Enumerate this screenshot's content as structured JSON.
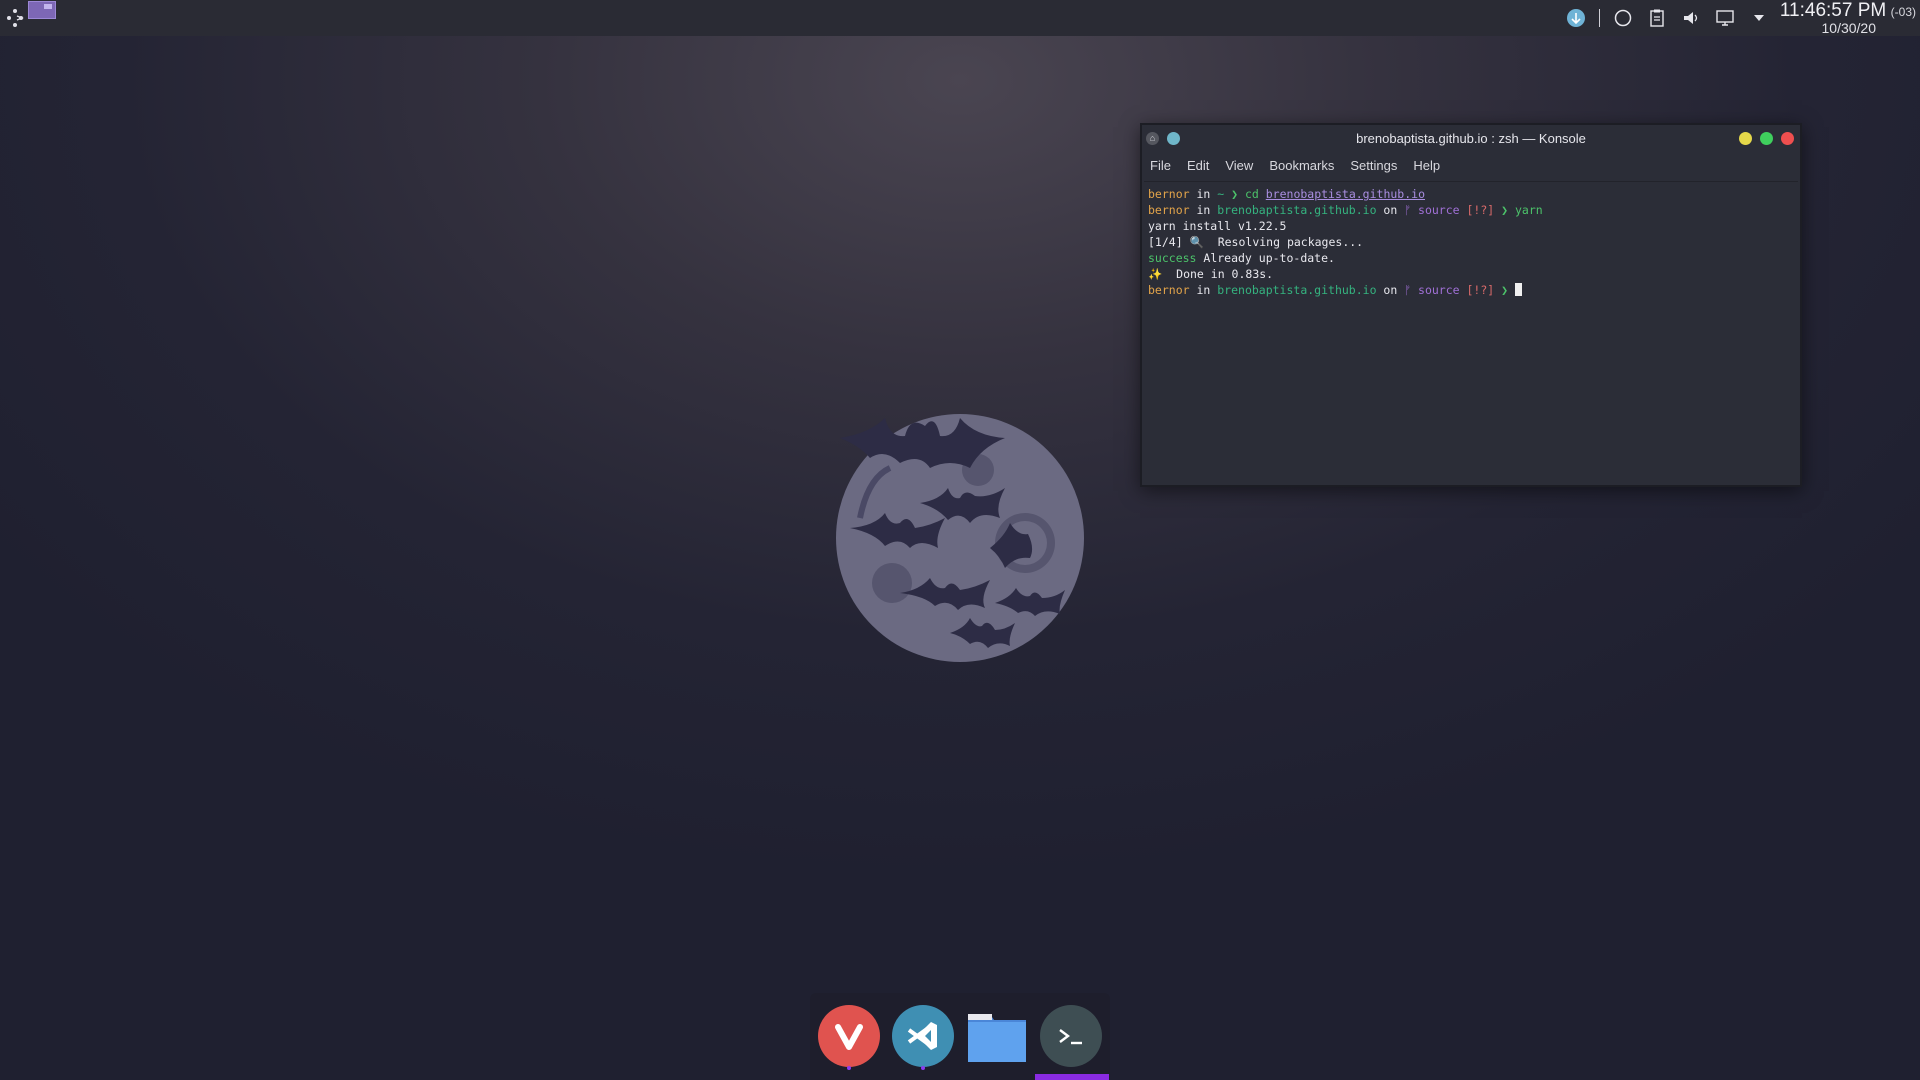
{
  "topbar": {
    "clock_time": "11:46:57 PM",
    "clock_tz": "(-03)",
    "clock_date": "10/30/20"
  },
  "window": {
    "title": "brenobaptista.github.io : zsh — Konsole",
    "menu": [
      "File",
      "Edit",
      "View",
      "Bookmarks",
      "Settings",
      "Help"
    ]
  },
  "terminal": {
    "line1": {
      "user": "bernor",
      "in": " in ",
      "dir": "~",
      "arrow": " ❯ ",
      "cmd": "cd ",
      "arg": "brenobaptista.github.io"
    },
    "line2": {
      "user": "bernor",
      "in": " in ",
      "dir": "brenobaptista.github.io",
      "on": " on ",
      "branch": "ᚠ source",
      "status": " [!?]",
      "arrow": " ❯ ",
      "cmd": "yarn"
    },
    "line3": "yarn install v1.22.5",
    "line4": "[1/4] 🔍  Resolving packages...",
    "line5": {
      "success": "success",
      "rest": " Already up-to-date."
    },
    "line6": "✨  Done in 0.83s.",
    "line7": {
      "user": "bernor",
      "in": " in ",
      "dir": "brenobaptista.github.io",
      "on": " on ",
      "branch": "ᚠ source",
      "status": " [!?]",
      "arrow": " ❯ "
    }
  },
  "dock": {
    "items": [
      "vivaldi-browser",
      "vscode",
      "file-manager",
      "konsole-terminal"
    ]
  },
  "colors": {
    "accent": "#8a2be2",
    "vivaldi": "#e0534f",
    "vscode": "#3f8fb3",
    "folder": "#5a9ae8",
    "konsole": "#3e4e53"
  }
}
